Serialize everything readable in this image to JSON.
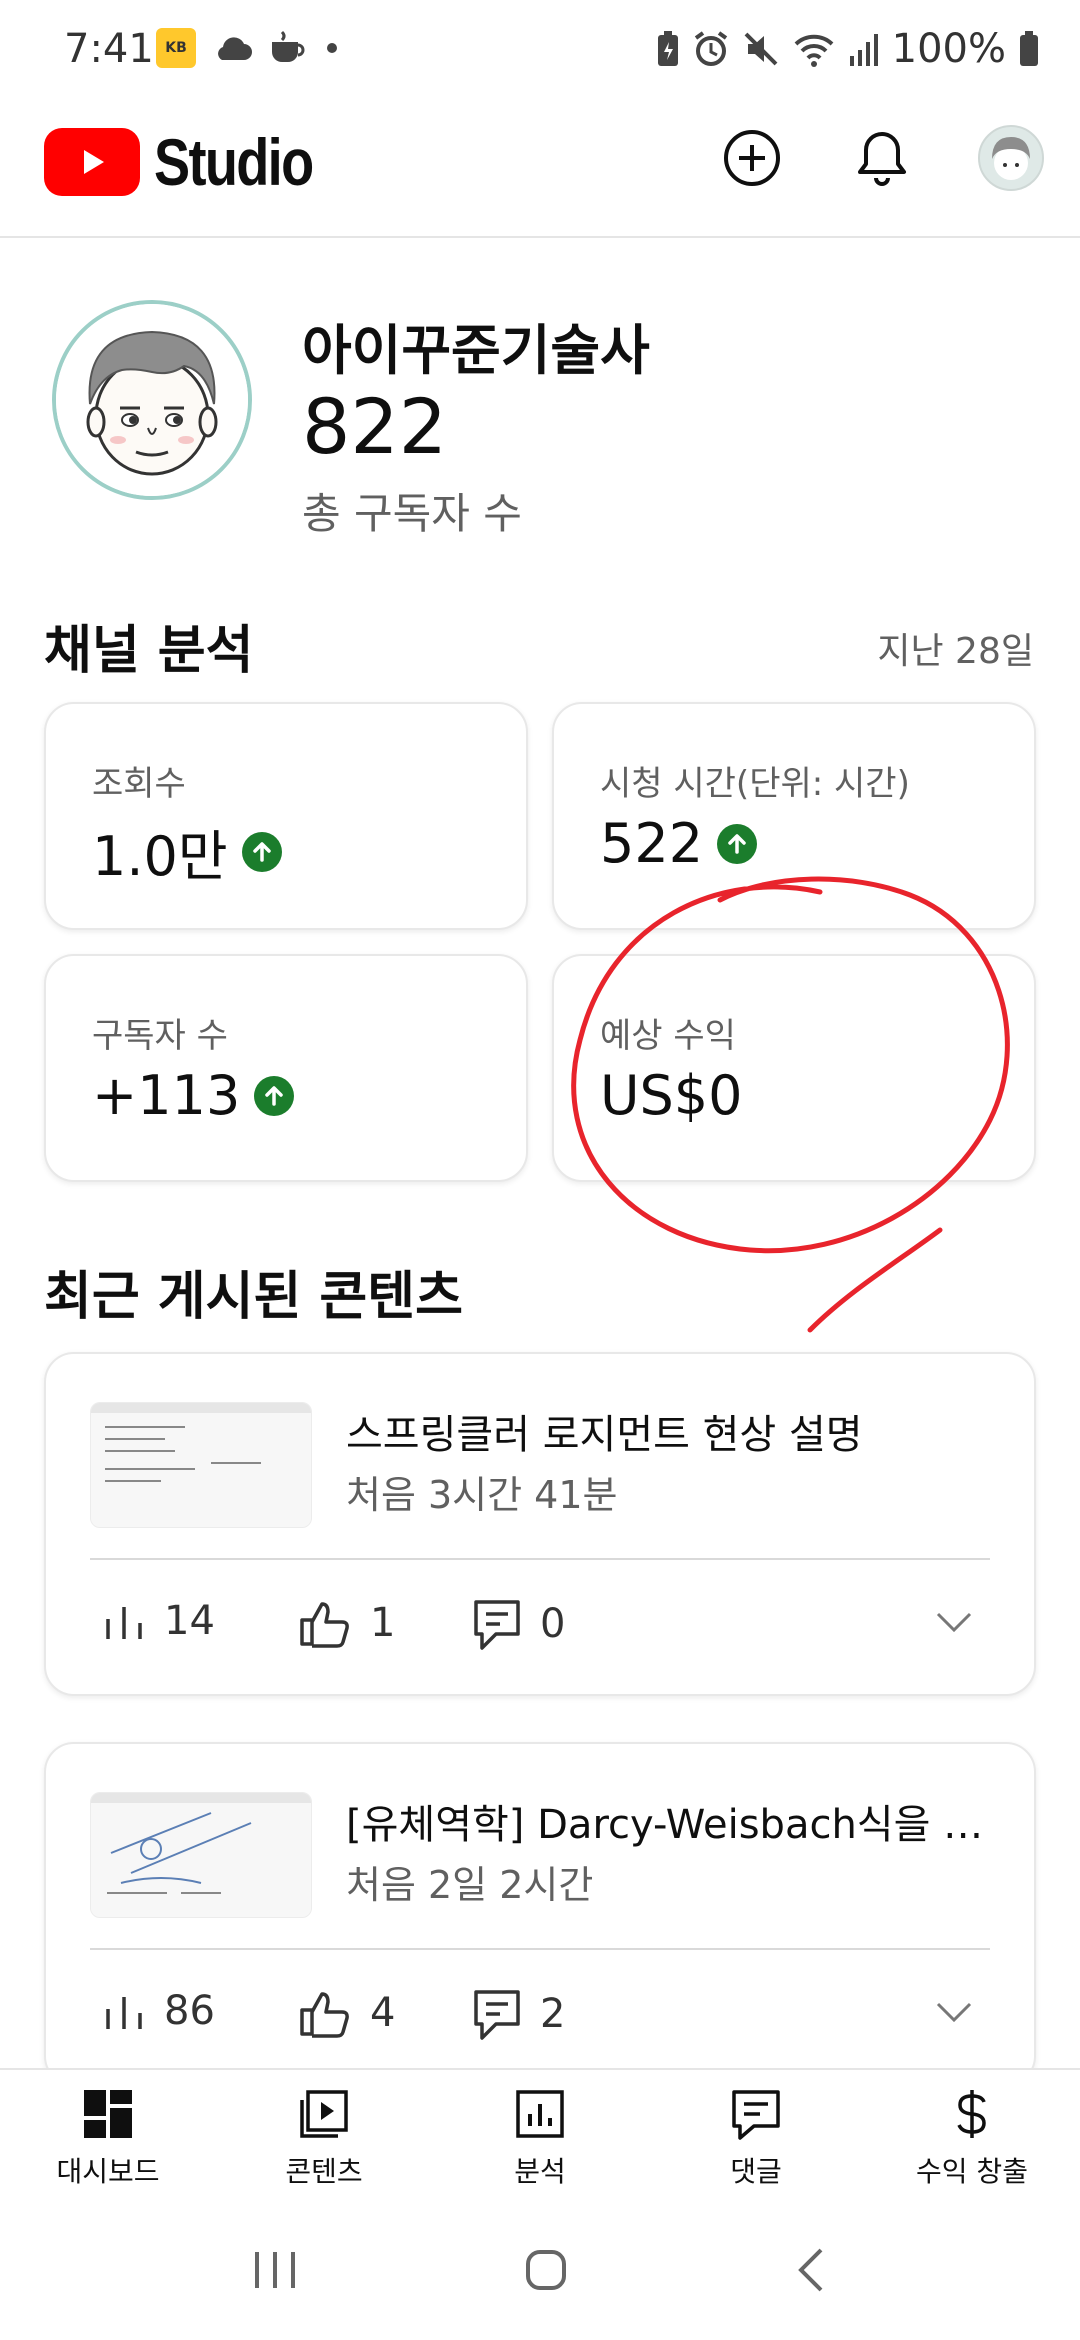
{
  "status_bar": {
    "time": "7:41",
    "kb_badge": "KB",
    "battery": "100%"
  },
  "app_bar": {
    "logo_text": "Studio"
  },
  "profile": {
    "channel_name": "아이꾸준기술사",
    "subscriber_count": "822",
    "subscriber_label": "총 구독자 수"
  },
  "analytics": {
    "title": "채널 분석",
    "period": "지난 28일",
    "cards": [
      {
        "label": "조회수",
        "value": "1.0만",
        "trend": "up"
      },
      {
        "label": "시청 시간(단위: 시간)",
        "value": "522",
        "trend": "up"
      },
      {
        "label": "구독자 수",
        "value": "+113",
        "trend": "up"
      },
      {
        "label": "예상 수익",
        "value": "US$0",
        "trend": "none"
      }
    ],
    "colors": {
      "trend_up": "#1b7d2c",
      "annotation": "#e8242c"
    }
  },
  "recent": {
    "title": "최근 게시된 콘텐츠",
    "items": [
      {
        "title": "스프링클러 로지먼트 현상 설명",
        "age": "처음 3시간 41분",
        "views": "14",
        "likes": "1",
        "comments": "0"
      },
      {
        "title": "[유체역학] Darcy-Weisbach식을 유도해보자",
        "age": "처음 2일 2시간",
        "views": "86",
        "likes": "4",
        "comments": "2"
      }
    ]
  },
  "bottom_nav": [
    {
      "label": "대시보드",
      "icon": "dashboard-icon"
    },
    {
      "label": "콘텐츠",
      "icon": "content-icon"
    },
    {
      "label": "분석",
      "icon": "analytics-icon"
    },
    {
      "label": "댓글",
      "icon": "comments-icon"
    },
    {
      "label": "수익 창출",
      "icon": "dollar-icon"
    }
  ]
}
